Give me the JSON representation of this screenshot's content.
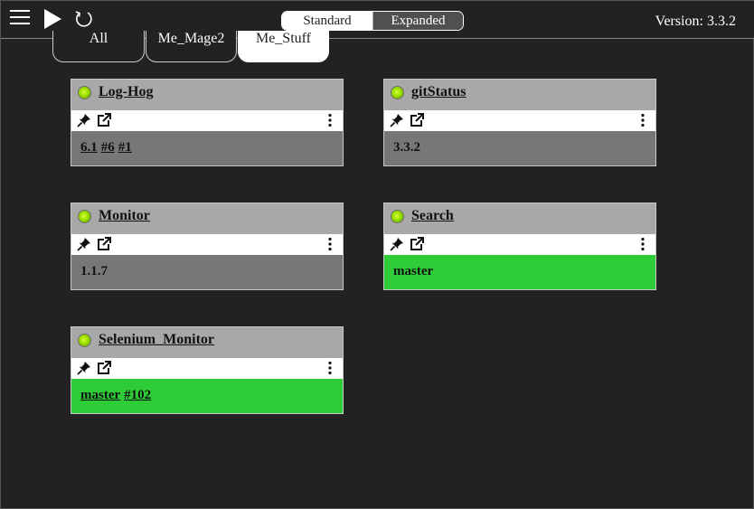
{
  "header": {
    "view_toggle": {
      "standard": "Standard",
      "expanded": "Expanded",
      "selected": "Standard"
    },
    "version_text": "Version: 3.3.2"
  },
  "tabs": [
    {
      "label": "All",
      "selected": false
    },
    {
      "label": "Me_Mage2",
      "selected": false
    },
    {
      "label": "Me_Stuff",
      "selected": true
    }
  ],
  "cards": [
    {
      "title": "Log-Hog",
      "status": "grey",
      "links": [
        "6.1",
        "#6",
        "#1"
      ],
      "text": ""
    },
    {
      "title": "gitStatus",
      "status": "grey",
      "links": [],
      "text": "3.3.2"
    },
    {
      "title": "Monitor",
      "status": "grey",
      "links": [],
      "text": "1.1.7"
    },
    {
      "title": "Search",
      "status": "green",
      "links": [],
      "text": "master"
    },
    {
      "title": "Selenium_Monitor",
      "status": "green",
      "links": [
        "master",
        "#102"
      ],
      "text": ""
    }
  ],
  "colors": {
    "background": "#222222",
    "card_header": "#a8a8a8",
    "status_grey": "#777777",
    "status_green": "#2ecc36",
    "led": "#9adf00"
  },
  "icons": {
    "menu": "hamburger-icon",
    "run": "play-icon",
    "reload": "refresh-icon",
    "pin": "pin-icon",
    "popout": "popout-icon",
    "more": "more-vertical-icon"
  }
}
